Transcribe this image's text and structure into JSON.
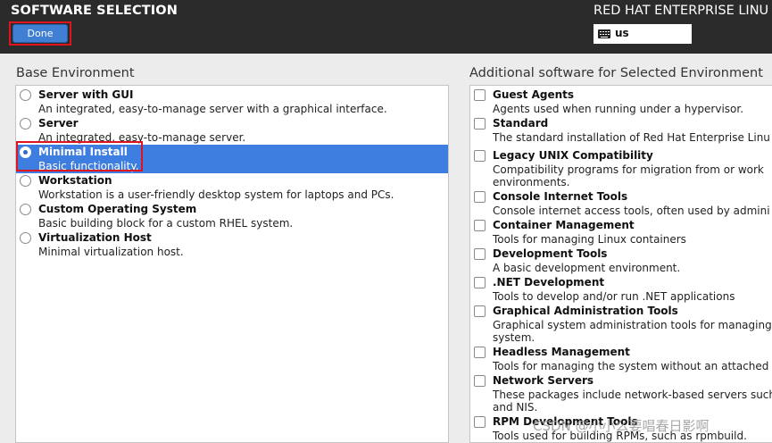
{
  "header": {
    "title": "SOFTWARE SELECTION",
    "product": "RED HAT ENTERPRISE LINU",
    "done_label": "Done",
    "keyboard_layout": "us",
    "keyboard_icon": "keyboard-icon"
  },
  "base_environment": {
    "heading": "Base Environment",
    "items": [
      {
        "title": "Server with GUI",
        "desc": "An integrated, easy-to-manage server with a graphical interface.",
        "selected": false
      },
      {
        "title": "Server",
        "desc": "An integrated, easy-to-manage server.",
        "selected": false
      },
      {
        "title": "Minimal Install",
        "desc": "Basic functionality.",
        "selected": true
      },
      {
        "title": "Workstation",
        "desc": "Workstation is a user-friendly desktop system for laptops and PCs.",
        "selected": false
      },
      {
        "title": "Custom Operating System",
        "desc": "Basic building block for a custom RHEL system.",
        "selected": false
      },
      {
        "title": "Virtualization Host",
        "desc": "Minimal virtualization host.",
        "selected": false
      }
    ]
  },
  "additional_software": {
    "heading": "Additional software for Selected Environment",
    "items": [
      {
        "title": "Guest Agents",
        "desc": "Agents used when running under a hypervisor.",
        "checked": false
      },
      {
        "title": "Standard",
        "desc": "The standard installation of Red Hat Enterprise Linu",
        "checked": false
      },
      {
        "title": "Legacy UNIX Compatibility",
        "desc": "Compatibility programs for migration from or work environments.",
        "checked": false
      },
      {
        "title": "Console Internet Tools",
        "desc": "Console internet access tools, often used by admini",
        "checked": false
      },
      {
        "title": "Container Management",
        "desc": "Tools for managing Linux containers",
        "checked": false
      },
      {
        "title": "Development Tools",
        "desc": "A basic development environment.",
        "checked": false
      },
      {
        "title": ".NET Development",
        "desc": "Tools to develop and/or run .NET applications",
        "checked": false
      },
      {
        "title": "Graphical Administration Tools",
        "desc": "Graphical system administration tools for managing system.",
        "checked": false
      },
      {
        "title": "Headless Management",
        "desc": "Tools for managing the system without an attached",
        "checked": false
      },
      {
        "title": "Network Servers",
        "desc": "These packages include network-based servers such and NIS.",
        "checked": false
      },
      {
        "title": "RPM Development Tools",
        "desc": "Tools used for building RPMs, such as rpmbuild.",
        "checked": false
      }
    ]
  },
  "watermark": "CSDN @小小么要唱春日影啊",
  "colors": {
    "topbar": "#2b2b2b",
    "selection": "#3d7ee0",
    "done_button": "#3f7fd4",
    "highlight_box": "#e0141e"
  }
}
